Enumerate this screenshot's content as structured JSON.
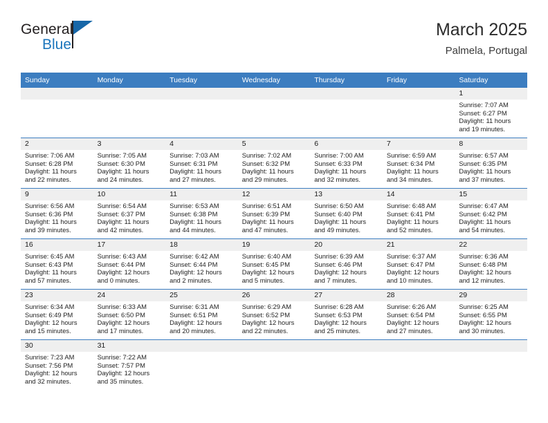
{
  "brand": {
    "name_top": "General",
    "name_bottom": "Blue",
    "color_primary": "#1b75bc",
    "color_dark": "#231f20"
  },
  "header": {
    "title": "March 2025",
    "subtitle": "Palmela, Portugal"
  },
  "theme": {
    "header_blue": "#3C7DC0",
    "daynum_band": "#efefef",
    "grid_line": "#3C7DC0"
  },
  "weekdays": [
    "Sunday",
    "Monday",
    "Tuesday",
    "Wednesday",
    "Thursday",
    "Friday",
    "Saturday"
  ],
  "weeks": [
    [
      {
        "day": "",
        "sunrise": "",
        "sunset": "",
        "daylight_line1": "",
        "daylight_line2": "",
        "empty": true
      },
      {
        "day": "",
        "sunrise": "",
        "sunset": "",
        "daylight_line1": "",
        "daylight_line2": "",
        "empty": true
      },
      {
        "day": "",
        "sunrise": "",
        "sunset": "",
        "daylight_line1": "",
        "daylight_line2": "",
        "empty": true
      },
      {
        "day": "",
        "sunrise": "",
        "sunset": "",
        "daylight_line1": "",
        "daylight_line2": "",
        "empty": true
      },
      {
        "day": "",
        "sunrise": "",
        "sunset": "",
        "daylight_line1": "",
        "daylight_line2": "",
        "empty": true
      },
      {
        "day": "",
        "sunrise": "",
        "sunset": "",
        "daylight_line1": "",
        "daylight_line2": "",
        "empty": true
      },
      {
        "day": "1",
        "sunrise": "Sunrise: 7:07 AM",
        "sunset": "Sunset: 6:27 PM",
        "daylight_line1": "Daylight: 11 hours",
        "daylight_line2": "and 19 minutes."
      }
    ],
    [
      {
        "day": "2",
        "sunrise": "Sunrise: 7:06 AM",
        "sunset": "Sunset: 6:28 PM",
        "daylight_line1": "Daylight: 11 hours",
        "daylight_line2": "and 22 minutes."
      },
      {
        "day": "3",
        "sunrise": "Sunrise: 7:05 AM",
        "sunset": "Sunset: 6:30 PM",
        "daylight_line1": "Daylight: 11 hours",
        "daylight_line2": "and 24 minutes."
      },
      {
        "day": "4",
        "sunrise": "Sunrise: 7:03 AM",
        "sunset": "Sunset: 6:31 PM",
        "daylight_line1": "Daylight: 11 hours",
        "daylight_line2": "and 27 minutes."
      },
      {
        "day": "5",
        "sunrise": "Sunrise: 7:02 AM",
        "sunset": "Sunset: 6:32 PM",
        "daylight_line1": "Daylight: 11 hours",
        "daylight_line2": "and 29 minutes."
      },
      {
        "day": "6",
        "sunrise": "Sunrise: 7:00 AM",
        "sunset": "Sunset: 6:33 PM",
        "daylight_line1": "Daylight: 11 hours",
        "daylight_line2": "and 32 minutes."
      },
      {
        "day": "7",
        "sunrise": "Sunrise: 6:59 AM",
        "sunset": "Sunset: 6:34 PM",
        "daylight_line1": "Daylight: 11 hours",
        "daylight_line2": "and 34 minutes."
      },
      {
        "day": "8",
        "sunrise": "Sunrise: 6:57 AM",
        "sunset": "Sunset: 6:35 PM",
        "daylight_line1": "Daylight: 11 hours",
        "daylight_line2": "and 37 minutes."
      }
    ],
    [
      {
        "day": "9",
        "sunrise": "Sunrise: 6:56 AM",
        "sunset": "Sunset: 6:36 PM",
        "daylight_line1": "Daylight: 11 hours",
        "daylight_line2": "and 39 minutes."
      },
      {
        "day": "10",
        "sunrise": "Sunrise: 6:54 AM",
        "sunset": "Sunset: 6:37 PM",
        "daylight_line1": "Daylight: 11 hours",
        "daylight_line2": "and 42 minutes."
      },
      {
        "day": "11",
        "sunrise": "Sunrise: 6:53 AM",
        "sunset": "Sunset: 6:38 PM",
        "daylight_line1": "Daylight: 11 hours",
        "daylight_line2": "and 44 minutes."
      },
      {
        "day": "12",
        "sunrise": "Sunrise: 6:51 AM",
        "sunset": "Sunset: 6:39 PM",
        "daylight_line1": "Daylight: 11 hours",
        "daylight_line2": "and 47 minutes."
      },
      {
        "day": "13",
        "sunrise": "Sunrise: 6:50 AM",
        "sunset": "Sunset: 6:40 PM",
        "daylight_line1": "Daylight: 11 hours",
        "daylight_line2": "and 49 minutes."
      },
      {
        "day": "14",
        "sunrise": "Sunrise: 6:48 AM",
        "sunset": "Sunset: 6:41 PM",
        "daylight_line1": "Daylight: 11 hours",
        "daylight_line2": "and 52 minutes."
      },
      {
        "day": "15",
        "sunrise": "Sunrise: 6:47 AM",
        "sunset": "Sunset: 6:42 PM",
        "daylight_line1": "Daylight: 11 hours",
        "daylight_line2": "and 54 minutes."
      }
    ],
    [
      {
        "day": "16",
        "sunrise": "Sunrise: 6:45 AM",
        "sunset": "Sunset: 6:43 PM",
        "daylight_line1": "Daylight: 11 hours",
        "daylight_line2": "and 57 minutes."
      },
      {
        "day": "17",
        "sunrise": "Sunrise: 6:43 AM",
        "sunset": "Sunset: 6:44 PM",
        "daylight_line1": "Daylight: 12 hours",
        "daylight_line2": "and 0 minutes."
      },
      {
        "day": "18",
        "sunrise": "Sunrise: 6:42 AM",
        "sunset": "Sunset: 6:44 PM",
        "daylight_line1": "Daylight: 12 hours",
        "daylight_line2": "and 2 minutes."
      },
      {
        "day": "19",
        "sunrise": "Sunrise: 6:40 AM",
        "sunset": "Sunset: 6:45 PM",
        "daylight_line1": "Daylight: 12 hours",
        "daylight_line2": "and 5 minutes."
      },
      {
        "day": "20",
        "sunrise": "Sunrise: 6:39 AM",
        "sunset": "Sunset: 6:46 PM",
        "daylight_line1": "Daylight: 12 hours",
        "daylight_line2": "and 7 minutes."
      },
      {
        "day": "21",
        "sunrise": "Sunrise: 6:37 AM",
        "sunset": "Sunset: 6:47 PM",
        "daylight_line1": "Daylight: 12 hours",
        "daylight_line2": "and 10 minutes."
      },
      {
        "day": "22",
        "sunrise": "Sunrise: 6:36 AM",
        "sunset": "Sunset: 6:48 PM",
        "daylight_line1": "Daylight: 12 hours",
        "daylight_line2": "and 12 minutes."
      }
    ],
    [
      {
        "day": "23",
        "sunrise": "Sunrise: 6:34 AM",
        "sunset": "Sunset: 6:49 PM",
        "daylight_line1": "Daylight: 12 hours",
        "daylight_line2": "and 15 minutes."
      },
      {
        "day": "24",
        "sunrise": "Sunrise: 6:33 AM",
        "sunset": "Sunset: 6:50 PM",
        "daylight_line1": "Daylight: 12 hours",
        "daylight_line2": "and 17 minutes."
      },
      {
        "day": "25",
        "sunrise": "Sunrise: 6:31 AM",
        "sunset": "Sunset: 6:51 PM",
        "daylight_line1": "Daylight: 12 hours",
        "daylight_line2": "and 20 minutes."
      },
      {
        "day": "26",
        "sunrise": "Sunrise: 6:29 AM",
        "sunset": "Sunset: 6:52 PM",
        "daylight_line1": "Daylight: 12 hours",
        "daylight_line2": "and 22 minutes."
      },
      {
        "day": "27",
        "sunrise": "Sunrise: 6:28 AM",
        "sunset": "Sunset: 6:53 PM",
        "daylight_line1": "Daylight: 12 hours",
        "daylight_line2": "and 25 minutes."
      },
      {
        "day": "28",
        "sunrise": "Sunrise: 6:26 AM",
        "sunset": "Sunset: 6:54 PM",
        "daylight_line1": "Daylight: 12 hours",
        "daylight_line2": "and 27 minutes."
      },
      {
        "day": "29",
        "sunrise": "Sunrise: 6:25 AM",
        "sunset": "Sunset: 6:55 PM",
        "daylight_line1": "Daylight: 12 hours",
        "daylight_line2": "and 30 minutes."
      }
    ],
    [
      {
        "day": "30",
        "sunrise": "Sunrise: 7:23 AM",
        "sunset": "Sunset: 7:56 PM",
        "daylight_line1": "Daylight: 12 hours",
        "daylight_line2": "and 32 minutes."
      },
      {
        "day": "31",
        "sunrise": "Sunrise: 7:22 AM",
        "sunset": "Sunset: 7:57 PM",
        "daylight_line1": "Daylight: 12 hours",
        "daylight_line2": "and 35 minutes."
      },
      {
        "day": "",
        "sunrise": "",
        "sunset": "",
        "daylight_line1": "",
        "daylight_line2": "",
        "empty": true
      },
      {
        "day": "",
        "sunrise": "",
        "sunset": "",
        "daylight_line1": "",
        "daylight_line2": "",
        "empty": true
      },
      {
        "day": "",
        "sunrise": "",
        "sunset": "",
        "daylight_line1": "",
        "daylight_line2": "",
        "empty": true
      },
      {
        "day": "",
        "sunrise": "",
        "sunset": "",
        "daylight_line1": "",
        "daylight_line2": "",
        "empty": true
      },
      {
        "day": "",
        "sunrise": "",
        "sunset": "",
        "daylight_line1": "",
        "daylight_line2": "",
        "empty": true
      }
    ]
  ]
}
